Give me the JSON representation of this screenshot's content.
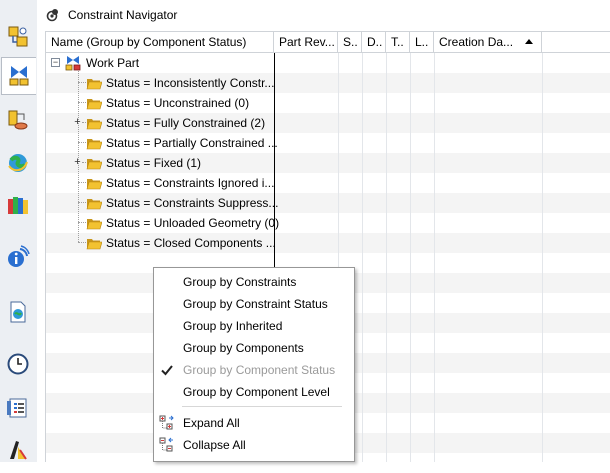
{
  "resource_bar": {
    "icons": [
      "assembly-navigator-icon",
      "constraint-navigator-icon",
      "part-navigator-icon",
      "web-browser-icon",
      "reuse-library-icon",
      "info-window-icon",
      "hd3d-tools-icon",
      "history-icon",
      "process-studio-icon",
      "color-palette-icon"
    ]
  },
  "navigator": {
    "title": "Constraint Navigator",
    "columns": [
      "Name (Group by Component Status)",
      "Part Rev...",
      "S..",
      "D..",
      "T..",
      "L..",
      "Creation Da..."
    ],
    "root": {
      "label": "Work Part"
    },
    "groups": [
      {
        "label": "Status = Inconsistently Constr...",
        "expandable": false
      },
      {
        "label": "Status = Unconstrained (0)",
        "expandable": false
      },
      {
        "label": "Status = Fully Constrained (2)",
        "expandable": true
      },
      {
        "label": "Status = Partially Constrained ...",
        "expandable": false
      },
      {
        "label": "Status = Fixed (1)",
        "expandable": true
      },
      {
        "label": "Status = Constraints Ignored i...",
        "expandable": false
      },
      {
        "label": "Status = Constraints Suppress...",
        "expandable": false
      },
      {
        "label": "Status = Unloaded Geometry (0)",
        "expandable": false
      },
      {
        "label": "Status = Closed Components ...",
        "expandable": false
      }
    ]
  },
  "context_menu": {
    "items": [
      {
        "label": "Group by Constraints",
        "enabled": true,
        "checked": false,
        "icon": ""
      },
      {
        "label": "Group by Constraint Status",
        "enabled": true,
        "checked": false,
        "icon": ""
      },
      {
        "label": "Group by Inherited",
        "enabled": true,
        "checked": false,
        "icon": ""
      },
      {
        "label": "Group by Components",
        "enabled": true,
        "checked": false,
        "icon": ""
      },
      {
        "label": "Group by Component Status",
        "enabled": false,
        "checked": true,
        "icon": ""
      },
      {
        "label": "Group by Component Level",
        "enabled": true,
        "checked": false,
        "icon": ""
      },
      {
        "label": "Expand All",
        "enabled": true,
        "checked": false,
        "icon": "expand-all-icon"
      },
      {
        "label": "Collapse All",
        "enabled": true,
        "checked": false,
        "icon": "collapse-all-icon"
      }
    ]
  },
  "colors": {
    "folder": "#f2c230",
    "folder_dark": "#c8961c",
    "sort_indicator": "#000000",
    "grid_line": "#cfd3d8"
  }
}
